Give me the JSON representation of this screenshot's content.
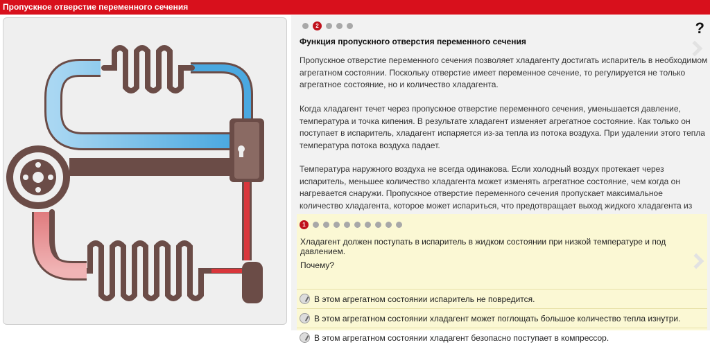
{
  "header": {
    "title": "Пропускное отверстие переменного сечения"
  },
  "nav": {
    "current_page": "2",
    "help": "?"
  },
  "content": {
    "heading": "Функция пропускного отверстия переменного сечения",
    "p1": "Пропускное отверстие переменного сечения позволяет хладагенту достигать испаритель в необходимом агрегатном состоянии. Поскольку отверстие имеет переменное сечение, то регулируется не только агрегатное состояние, но и количество хладагента.",
    "p2": "Когда хладагент течет через пропускное отверстие переменного сечения, уменьшается давление, температура и точка кипения. В результате хладагент изменяет агрегатное состояние. Как только он поступает в испаритель, хладагент испаряется из-за тепла из потока воздуха. При удалении этого тепла температура потока воздуха падает.",
    "p3": "Температура наружного воздуха не всегда одинакова. Если холодный воздух протекает через испаритель, меньшее количество хладагента может изменять агрегатное состояние, чем когда он нагревается снаружи. Пропускное отверстие переменного сечения пропускает максимальное количество хладагента, которое может испариться, что предотвращает выход жидкого хладагента из испарителя."
  },
  "quiz": {
    "current_page": "1",
    "question": "Хладагент должен поступать в испаритель в жидком состоянии при низкой температуре и под давлением.",
    "why": "Почему?",
    "options": [
      "В этом агрегатном состоянии испаритель не повредится.",
      "В этом агрегатном состоянии хладагент может поглощать большое количество тепла изнутри.",
      "В этом агрегатном состоянии хладагент безопасно поступает в компрессор."
    ]
  },
  "colors": {
    "brand": "#d8101c",
    "cold": "#5fb4e6",
    "hot": "#d9363b",
    "pipe": "#6b4c47"
  }
}
